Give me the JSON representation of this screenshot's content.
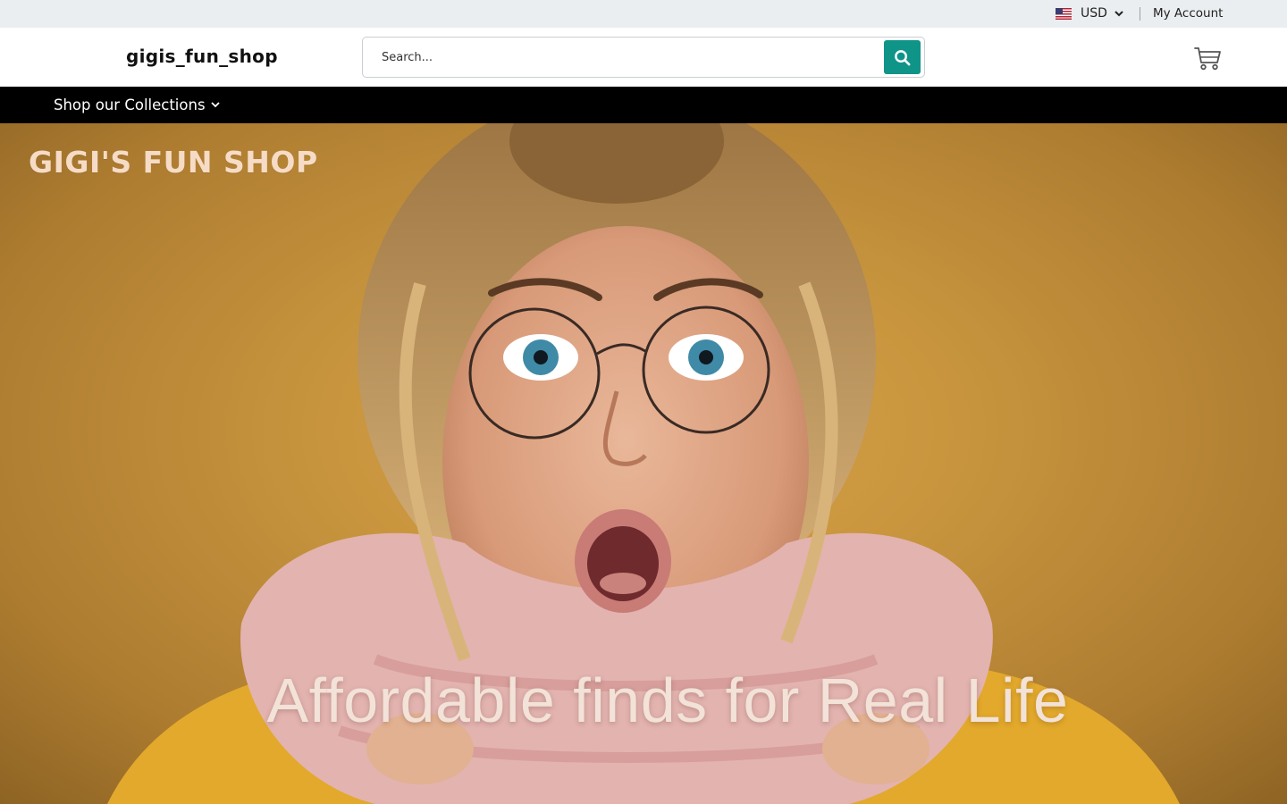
{
  "topbar": {
    "currency": "USD",
    "account_link": "My Account",
    "icons": {
      "flag": "us-flag-icon",
      "chevron": "chevron-down-icon"
    }
  },
  "header": {
    "logo_text": "gigis_fun_shop",
    "search": {
      "placeholder": "Search...",
      "value": ""
    },
    "icons": {
      "search": "search-icon",
      "cart": "cart-icon"
    },
    "accent_color": "#0f9488"
  },
  "nav": {
    "items": [
      {
        "label": "Shop our Collections"
      }
    ]
  },
  "hero": {
    "brand": "GIGI'S FUN SHOP",
    "headline": "Affordable finds for Real Life",
    "background_color": "#c8953e"
  }
}
